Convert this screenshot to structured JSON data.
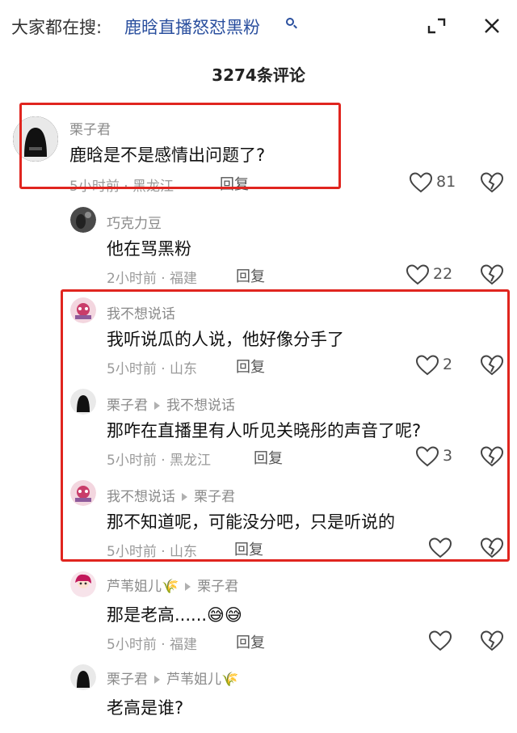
{
  "header": {
    "search_prefix": "大家都在搜:",
    "search_link": "鹿晗直播怒怼黑粉",
    "expand_icon": "expand-icon",
    "close_icon": "close-icon"
  },
  "comment_count": "3274条评论",
  "comments": [
    {
      "user": "栗子君",
      "reply_to": "",
      "text": "鹿晗是不是感情出问题了?",
      "meta": "5小时前 · 黑龙江",
      "reply": "回复",
      "likes": "81"
    },
    {
      "user": "巧克力豆",
      "reply_to": "",
      "text": "他在骂黑粉",
      "meta": "2小时前 · 福建",
      "reply": "回复",
      "likes": "22"
    },
    {
      "user": "我不想说话",
      "reply_to": "",
      "text": "我听说瓜的人说，他好像分手了",
      "meta": "5小时前 · 山东",
      "reply": "回复",
      "likes": "2"
    },
    {
      "user": "栗子君",
      "reply_to": "我不想说话",
      "text": "那咋在直播里有人听见关晓彤的声音了呢?",
      "meta": "5小时前 · 黑龙江",
      "reply": "回复",
      "likes": "3"
    },
    {
      "user": "我不想说话",
      "reply_to": "栗子君",
      "text": "那不知道呢，可能没分吧，只是听说的",
      "meta": "5小时前 · 山东",
      "reply": "回复",
      "likes": ""
    },
    {
      "user": "芦苇姐儿🌾",
      "reply_to": "栗子君",
      "text": "那是老高......😅😅",
      "meta": "5小时前 · 福建",
      "reply": "回复",
      "likes": ""
    },
    {
      "user": "栗子君",
      "reply_to": "芦苇姐儿🌾",
      "text": "老高是谁?",
      "meta": "",
      "reply": "",
      "likes": ""
    }
  ],
  "colors": {
    "link": "#2a4f9e",
    "highlight": "#e0251f"
  }
}
